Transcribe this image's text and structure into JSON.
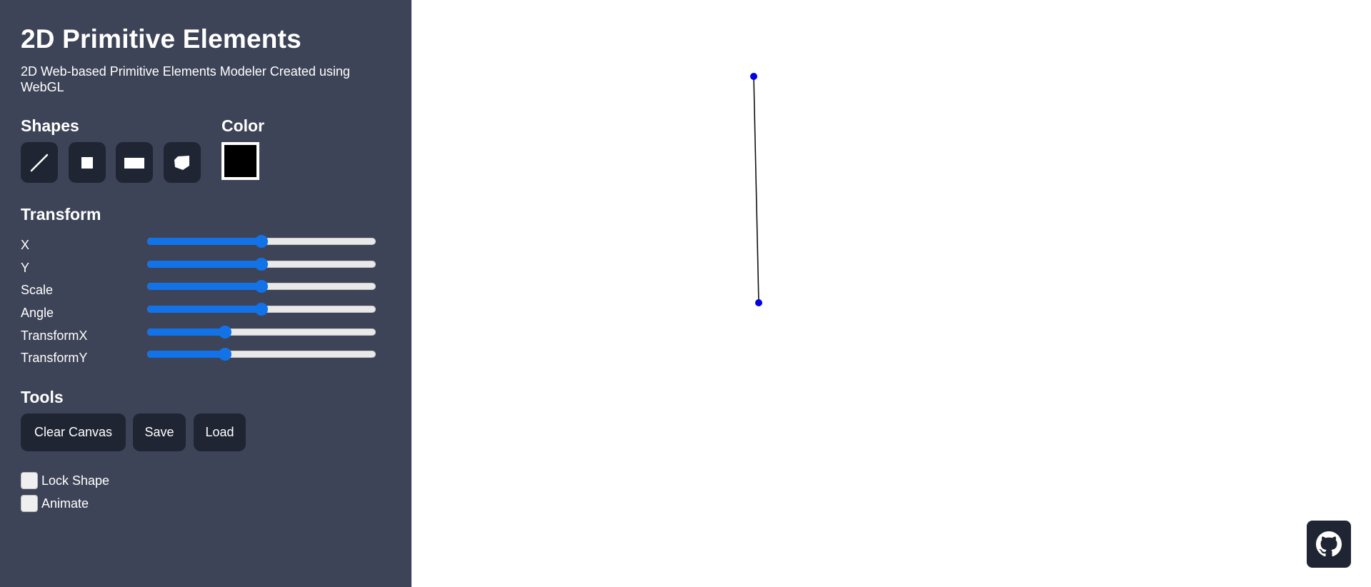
{
  "app": {
    "title": "2D Primitive Elements",
    "subtitle": "2D Web-based Primitive Elements Modeler Created using WebGL"
  },
  "shapes": {
    "heading": "Shapes",
    "buttons": [
      {
        "name": "line",
        "icon": "line-icon"
      },
      {
        "name": "square",
        "icon": "square-icon"
      },
      {
        "name": "rectangle",
        "icon": "rectangle-icon"
      },
      {
        "name": "polygon",
        "icon": "polygon-icon"
      }
    ]
  },
  "color": {
    "heading": "Color",
    "value": "#000000"
  },
  "transform": {
    "heading": "Transform",
    "sliders": [
      {
        "label": "X",
        "value": 0.5
      },
      {
        "label": "Y",
        "value": 0.5
      },
      {
        "label": "Scale",
        "value": 0.5
      },
      {
        "label": "Angle",
        "value": 0.5
      },
      {
        "label": "TransformX",
        "value": 0.34
      },
      {
        "label": "TransformY",
        "value": 0.34
      }
    ]
  },
  "tools": {
    "heading": "Tools",
    "clear_label": "Clear Canvas",
    "save_label": "Save",
    "load_label": "Load"
  },
  "options": {
    "lock_label": "Lock Shape",
    "lock_checked": false,
    "animate_label": "Animate",
    "animate_checked": false
  },
  "github": {
    "icon": "github-icon"
  },
  "colors": {
    "sidebar_bg": "#3e4457",
    "button_bg": "#1f2533",
    "accent": "#1273e8",
    "vertex": "#0000e0"
  }
}
